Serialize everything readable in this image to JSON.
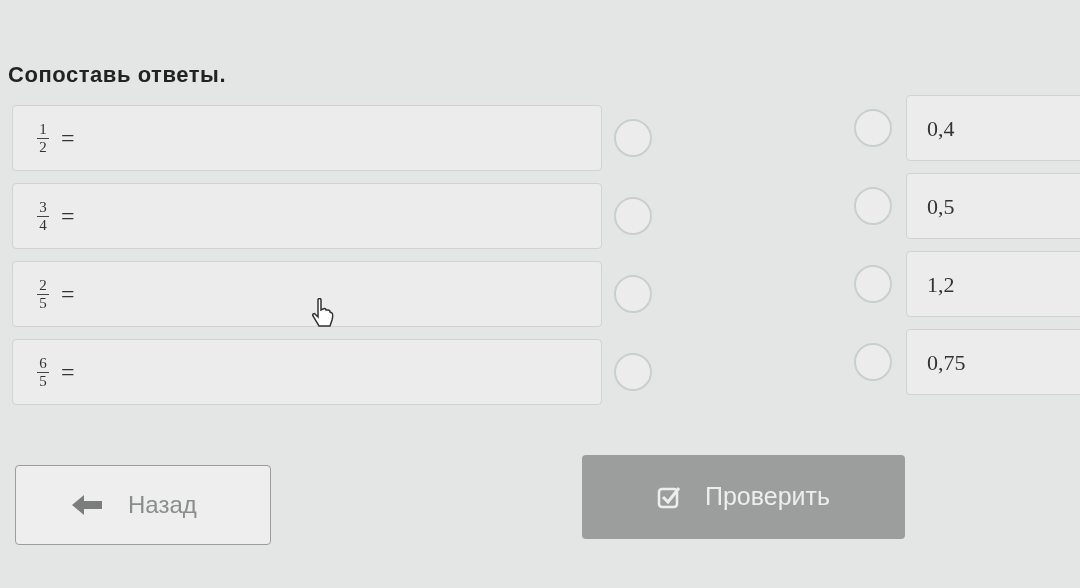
{
  "title": "Сопоставь ответы.",
  "left_items": [
    {
      "numerator": "1",
      "denominator": "2",
      "sign": "=",
      "selected": false
    },
    {
      "numerator": "3",
      "denominator": "4",
      "sign": "=",
      "selected": false
    },
    {
      "numerator": "2",
      "denominator": "5",
      "sign": "=",
      "selected": false
    },
    {
      "numerator": "6",
      "denominator": "5",
      "sign": "=",
      "selected": false
    }
  ],
  "right_items": [
    {
      "label": "0,4",
      "selected": false
    },
    {
      "label": "0,5",
      "selected": false
    },
    {
      "label": "1,2",
      "selected": false
    },
    {
      "label": "0,75",
      "selected": false
    }
  ],
  "back_button": {
    "label": "Назад"
  },
  "check_button": {
    "label": "Проверить",
    "disabled": true
  }
}
